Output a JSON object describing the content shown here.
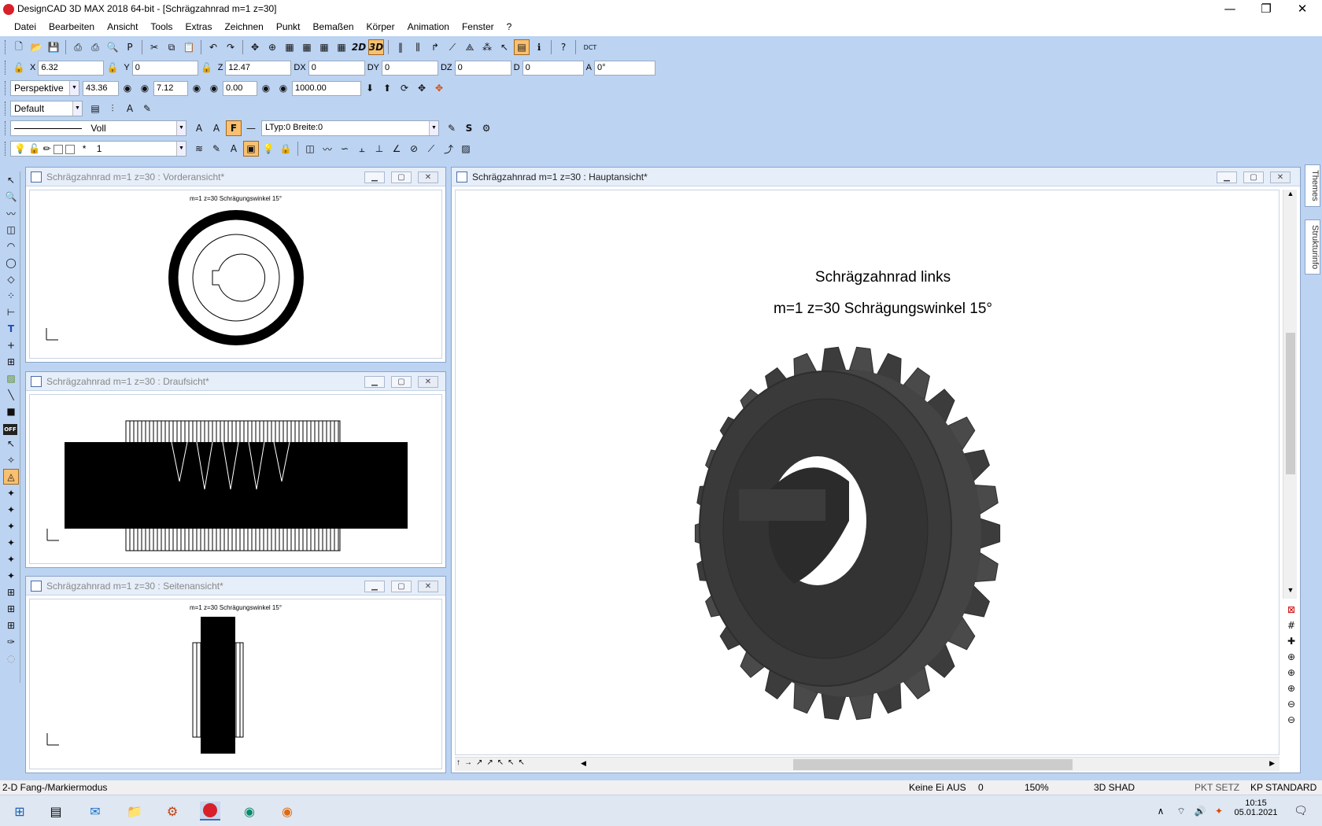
{
  "app": {
    "title": "DesignCAD 3D MAX 2018 64-bit - [Schrägzahnrad  m=1  z=30]",
    "win_minimize": "—",
    "win_restore": "❐",
    "win_close": "✕"
  },
  "menu": [
    "Datei",
    "Bearbeiten",
    "Ansicht",
    "Tools",
    "Extras",
    "Zeichnen",
    "Punkt",
    "Bemaßen",
    "Körper",
    "Animation",
    "Fenster",
    "?"
  ],
  "toolbar": {
    "dct_label": "DCT",
    "btn_2d": "2D",
    "btn_3d": "3D"
  },
  "coords": {
    "x_label": "X",
    "x": "6.32",
    "y_label": "Y",
    "y": "0",
    "z_label": "Z",
    "z": "12.47",
    "dx_label": "DX",
    "dx": "0",
    "dy_label": "DY",
    "dy": "0",
    "dz_label": "DZ",
    "dz": "0",
    "d_label": "D",
    "d": "0",
    "a_label": "A",
    "a": "0°"
  },
  "view": {
    "projection": "Perspektive",
    "v1": "43.36",
    "v2": "7.12",
    "v3": "0.00",
    "v4": "1000.00"
  },
  "style": {
    "name": "Default"
  },
  "line": {
    "type": "Voll",
    "info": "LTyp:0  Breite:0"
  },
  "layer": {
    "star": "*",
    "number": "1"
  },
  "left_tools": {
    "off_label": "OFF"
  },
  "windows": {
    "front": {
      "title": "Schrägzahnrad  m=1  z=30 : Vorderansicht*",
      "caption": "m=1  z=30  Schrägungswinkel  15°"
    },
    "top": {
      "title": "Schrägzahnrad  m=1  z=30 : Draufsicht*"
    },
    "side": {
      "title": "Schrägzahnrad  m=1  z=30 : Seitenansicht*",
      "caption": "m=1  z=30  Schrägungswinkel  15°"
    },
    "main": {
      "title": "Schrägzahnrad  m=1  z=30 : Hauptansicht*",
      "heading": "Schrägzahnrad links",
      "subheading": "m=1  z=30  Schrägungswinkel  15°"
    }
  },
  "right_tabs": [
    "Themes",
    "Strukturinfo"
  ],
  "status": {
    "mode": "2-D Fang-/Markiermodus",
    "keine": "Keine Ei",
    "aus": "AUS",
    "zero": "0",
    "zoom": "150%",
    "render": "3D SHAD",
    "pkt": "PKT SETZ",
    "kp": "KP STANDARD"
  },
  "taskbar": {
    "time": "10:15",
    "date": "05.01.2021"
  },
  "colors": {
    "workspace": "#bcd3f2",
    "gear": "#3a3a3a",
    "active_button": "#f8c070"
  }
}
